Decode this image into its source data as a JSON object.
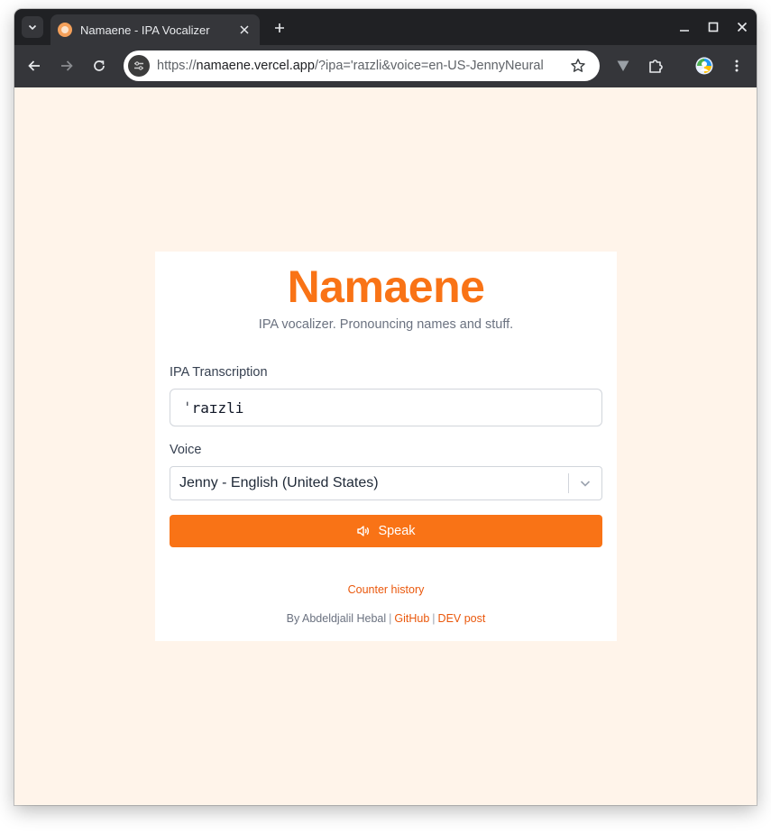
{
  "browser": {
    "tab_title": "Namaene - IPA Vocalizer",
    "url_scheme": "https://",
    "url_host": "namaene.vercel.app",
    "url_path": "/?ipa='raɪzli&voice=en-US-JennyNeural"
  },
  "app": {
    "title": "Namaene",
    "tagline": "IPA vocalizer. Pronouncing names and stuff.",
    "ipa_label": "IPA Transcription",
    "ipa_value": "ˈraɪzli",
    "voice_label": "Voice",
    "voice_selected": "Jenny - English (United States)",
    "speak_label": "Speak",
    "counter_history": "Counter history",
    "footer_by": "By Abdeldjalil Hebal",
    "footer_sep": "|",
    "footer_github": "GitHub",
    "footer_dev": "DEV post"
  },
  "colors": {
    "accent": "#f97316",
    "page_background": "#fff4ea",
    "link": "#ea580c"
  }
}
